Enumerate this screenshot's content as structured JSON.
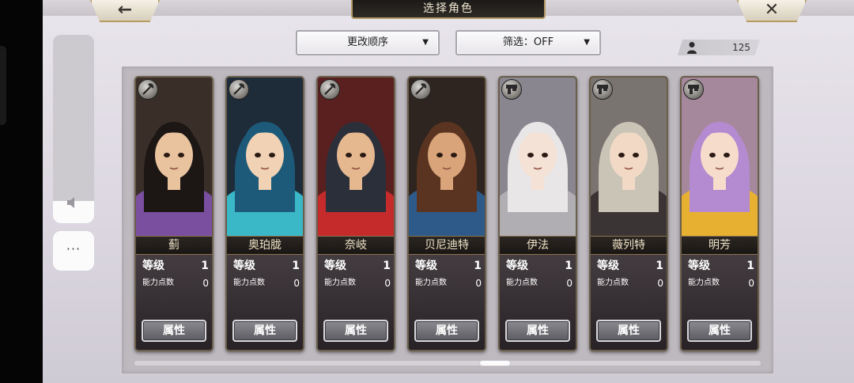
{
  "header": {
    "title": "选择角色",
    "back_icon": "←",
    "close_icon": "✕"
  },
  "controls": {
    "order_label": "更改顺序",
    "filter_label": "筛选：OFF",
    "dropdown_arrow": "▼"
  },
  "roster": {
    "count": "125"
  },
  "floating_menu": {
    "more_label": "···"
  },
  "labels": {
    "level": "等级",
    "ability_points": "能力点数",
    "attribute_button": "属性"
  },
  "characters": [
    {
      "name": "蓟",
      "level": "1",
      "points": "0",
      "weapon": "axe",
      "hair": "#1c1614",
      "accent": "#7a4fa0",
      "skin": "#e9c39e",
      "bg": "#3a2f28"
    },
    {
      "name": "奥珀胧",
      "level": "1",
      "points": "0",
      "weapon": "axe",
      "hair": "#1d5a7a",
      "accent": "#3ab8c8",
      "skin": "#f1d2b5",
      "bg": "#1e2c3a"
    },
    {
      "name": "奈岐",
      "level": "1",
      "points": "0",
      "weapon": "axe",
      "hair": "#2a2f3a",
      "accent": "#c52b2b",
      "skin": "#e6b890",
      "bg": "#5a1f1f"
    },
    {
      "name": "贝尼迪特",
      "level": "1",
      "points": "0",
      "weapon": "axe",
      "hair": "#5a3420",
      "accent": "#2e5a8a",
      "skin": "#d9a47a",
      "bg": "#2f2520"
    },
    {
      "name": "伊法",
      "level": "1",
      "points": "0",
      "weapon": "gun",
      "hair": "#e8e6e6",
      "accent": "#b0aeb2",
      "skin": "#f5e2d6",
      "bg": "#8a8690"
    },
    {
      "name": "薇列特",
      "level": "1",
      "points": "0",
      "weapon": "gun",
      "hair": "#c9c4b6",
      "accent": "#3a3534",
      "skin": "#f2d9c6",
      "bg": "#7a7470"
    },
    {
      "name": "明芳",
      "level": "1",
      "points": "0",
      "weapon": "gun",
      "hair": "#b48ad0",
      "accent": "#e8b030",
      "skin": "#f6dccb",
      "bg": "#a6889c"
    }
  ]
}
